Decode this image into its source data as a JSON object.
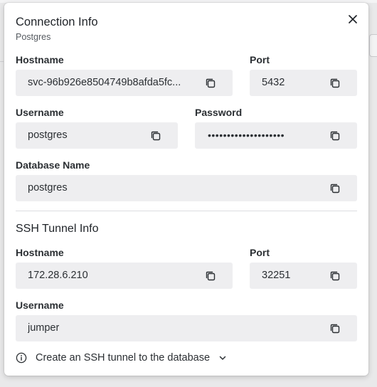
{
  "modal": {
    "title": "Connection Info",
    "subtitle": "Postgres",
    "close_icon": "close-icon"
  },
  "connection": {
    "hostname_label": "Hostname",
    "hostname_value": "svc-96b926e8504749b8afda5fc...",
    "port_label": "Port",
    "port_value": "5432",
    "username_label": "Username",
    "username_value": "postgres",
    "password_label": "Password",
    "password_value": "••••••••••••••••••••",
    "database_label": "Database Name",
    "database_value": "postgres"
  },
  "ssh": {
    "section_title": "SSH Tunnel Info",
    "hostname_label": "Hostname",
    "hostname_value": "172.28.6.210",
    "port_label": "Port",
    "port_value": "32251",
    "username_label": "Username",
    "username_value": "jumper",
    "tunnel_link": "Create an SSH tunnel to the database"
  },
  "icons": {
    "copy": "copy-icon",
    "info": "info-icon",
    "chevron": "chevron-down-icon"
  },
  "colors": {
    "field_bg": "#eeeef0",
    "text": "#2b2f33",
    "divider": "#dcdde0"
  }
}
